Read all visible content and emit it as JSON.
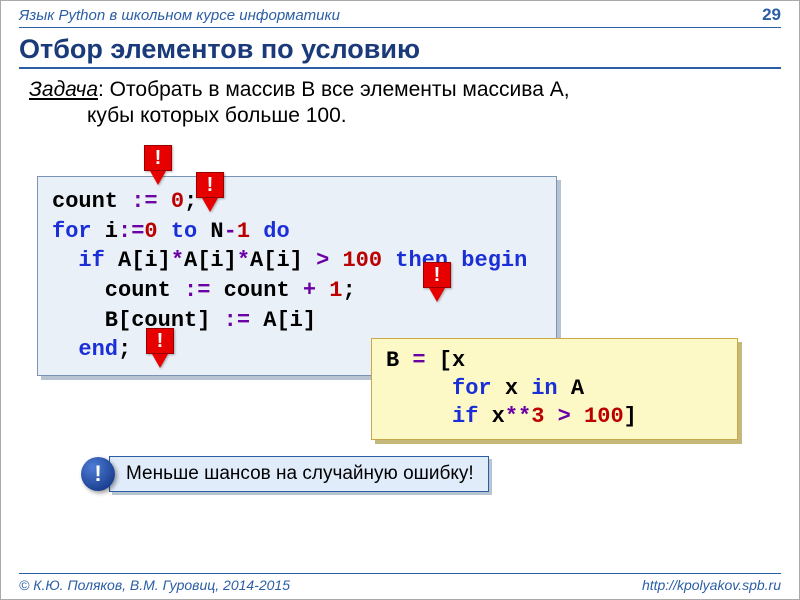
{
  "header": {
    "course": "Язык Python в школьном курсе информатики",
    "page": "29"
  },
  "title": "Отбор элементов по условию",
  "task": {
    "label": "Задача",
    "line1": ": Отобрать в массив B все элементы массива A,",
    "line2": "кубы которых больше 100."
  },
  "pascal": {
    "l1a": "count ",
    "l1op": ":=",
    "l1b": " ",
    "l1n": "0",
    "l1c": ";",
    "l2a": "for",
    "l2b": " i",
    "l2op1": ":=",
    "l2n": "0",
    "l2c": " ",
    "l2to": "to",
    "l2d": " N",
    "l2op2": "-",
    "l2e": "1",
    "l2f": " ",
    "l2do": "do",
    "l3a": "  ",
    "l3if": "if",
    "l3b": " A[i]",
    "l3op1": "*",
    "l3c": "A[i]",
    "l3op2": "*",
    "l3d": "A[i] ",
    "l3op3": ">",
    "l3e": " ",
    "l3n": "100",
    "l3f": " ",
    "l3then": "then",
    "l3g": " ",
    "l3begin": "begin",
    "l4a": "    count ",
    "l4op": ":=",
    "l4b": " count ",
    "l4op2": "+",
    "l4c": " ",
    "l4n": "1",
    "l4d": ";",
    "l5a": "    B[count] ",
    "l5op": ":=",
    "l5b": " A[i]",
    "l6a": "  ",
    "l6end": "end",
    "l6b": ";"
  },
  "python": {
    "l1a": "B ",
    "l1op": "=",
    "l1b": " [x",
    "l2a": "     ",
    "l2for": "for",
    "l2b": " x ",
    "l2in": "in",
    "l2c": " A",
    "l3a": "     ",
    "l3if": "if",
    "l3b": " x",
    "l3op1": "**",
    "l3n1": "3",
    "l3c": " ",
    "l3op2": ">",
    "l3d": " ",
    "l3n2": "100",
    "l3e": "]"
  },
  "callout": {
    "badge": "!",
    "text": "Меньше шансов на случайную ошибку!"
  },
  "exclam": "!",
  "footer": {
    "left": "© К.Ю. Поляков, В.М. Гуровиц, 2014-2015",
    "right": "http://kpolyakov.spb.ru"
  }
}
